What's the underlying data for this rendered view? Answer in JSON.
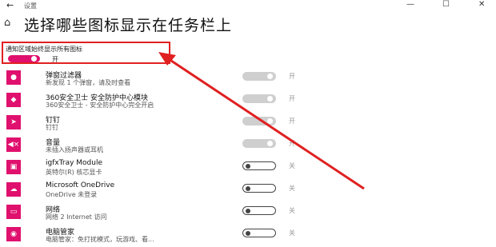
{
  "window": {
    "back_glyph": "←",
    "title": "设置",
    "minimize_glyph": "—",
    "maximize_glyph": "☐",
    "close_glyph": "✕"
  },
  "header": {
    "home_glyph": "⌂",
    "title": "选择哪些图标显示在任务栏上"
  },
  "always_show": {
    "label": "通知区域始终显示所有图标",
    "state": "开",
    "on": true
  },
  "apps": [
    {
      "icon": "notification-bell-icon",
      "glyph": "●",
      "name": "弹窗过滤器",
      "sub": "新发现 1 个弹窗，请及时查看",
      "state": "开",
      "on": true
    },
    {
      "icon": "shield-icon",
      "glyph": "◆",
      "name": "360安全卫士 安全防护中心模块",
      "sub": "360安全卫士 - 安全防护中心完全开启",
      "state": "开",
      "on": true
    },
    {
      "icon": "paper-plane-icon",
      "glyph": "➤",
      "name": "钉钉",
      "sub": "钉钉",
      "state": "开",
      "on": true
    },
    {
      "icon": "speaker-muted-icon",
      "glyph": "◀×",
      "name": "音量",
      "sub": "未插入扬声器或耳机",
      "state": "开",
      "on": true
    },
    {
      "icon": "graphics-driver-icon",
      "glyph": "▣",
      "name": "igfxTray Module",
      "sub": "英特尔(R) 核芯显卡",
      "state": "关",
      "on": false
    },
    {
      "icon": "cloud-icon",
      "glyph": "☁",
      "name": "Microsoft OneDrive",
      "sub": "OneDrive 未登录",
      "state": "关",
      "on": false
    },
    {
      "icon": "network-icon",
      "glyph": "▭",
      "name": "网络",
      "sub": "网络 2 Internet 访问",
      "state": "关",
      "on": false
    },
    {
      "icon": "pc-manager-icon",
      "glyph": "◉",
      "name": "电脑管家",
      "sub": "电脑管家：免打扰模式，玩游戏、看...",
      "state": "关",
      "on": false
    }
  ],
  "colors": {
    "accent": "#e0106e",
    "annotation": "#e02020"
  }
}
